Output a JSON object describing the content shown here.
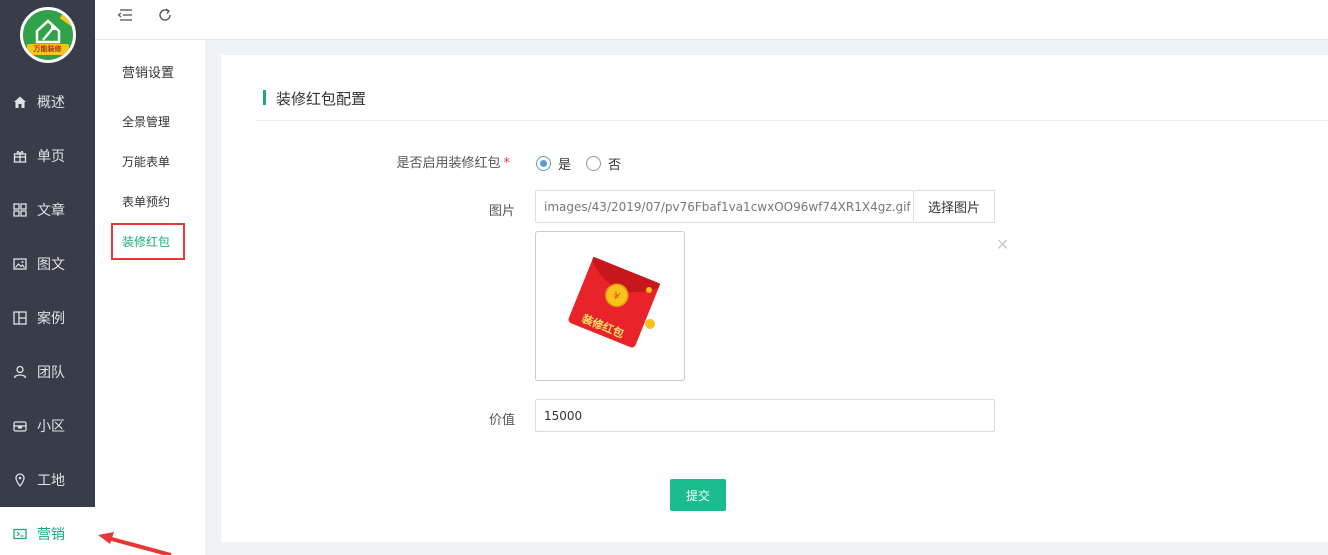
{
  "sidebar": {
    "logo_text": "万能装修",
    "items": [
      {
        "label": "概述",
        "icon": "home-icon"
      },
      {
        "label": "单页",
        "icon": "gift-icon"
      },
      {
        "label": "文章",
        "icon": "grid-icon"
      },
      {
        "label": "图文",
        "icon": "image-icon"
      },
      {
        "label": "案例",
        "icon": "layout-icon"
      },
      {
        "label": "团队",
        "icon": "user-icon"
      },
      {
        "label": "小区",
        "icon": "building-icon"
      },
      {
        "label": "工地",
        "icon": "location-icon"
      },
      {
        "label": "营销",
        "icon": "marketing-icon"
      }
    ],
    "active_index": 8
  },
  "subnav": {
    "title": "营销设置",
    "items": [
      "全景管理",
      "万能表单",
      "表单预约",
      "装修红包"
    ],
    "active_index": 3
  },
  "toolbar": {
    "collapse_icon": "menu-collapse-icon",
    "refresh_icon": "refresh-icon"
  },
  "form": {
    "title": "装修红包配置",
    "enable_label": "是否启用装修红包",
    "required_mark": "*",
    "option_yes": "是",
    "option_no": "否",
    "selected": "是",
    "image_label": "图片",
    "image_path": "images/43/2019/07/pv76Fbaf1va1cwxOO96wf74XR1X4gz.gif",
    "select_image_label": "选择图片",
    "thumb_text": "装修红包",
    "close_glyph": "✕",
    "value_label": "价值",
    "value": "15000",
    "submit_label": "提交"
  },
  "colors": {
    "accent": "#1aaa7e",
    "sidebar_bg": "#393d49",
    "highlight_box": "#e53935"
  }
}
